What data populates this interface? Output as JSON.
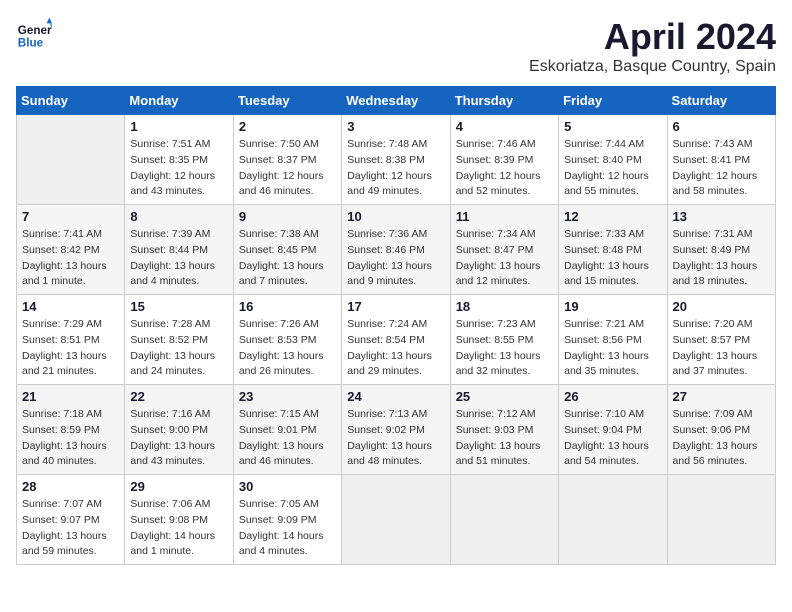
{
  "header": {
    "logo_general": "General",
    "logo_blue": "Blue",
    "month": "April 2024",
    "location": "Eskoriatza, Basque Country, Spain"
  },
  "days_of_week": [
    "Sunday",
    "Monday",
    "Tuesday",
    "Wednesday",
    "Thursday",
    "Friday",
    "Saturday"
  ],
  "weeks": [
    [
      {
        "day": "",
        "info": ""
      },
      {
        "day": "1",
        "info": "Sunrise: 7:51 AM\nSunset: 8:35 PM\nDaylight: 12 hours\nand 43 minutes."
      },
      {
        "day": "2",
        "info": "Sunrise: 7:50 AM\nSunset: 8:37 PM\nDaylight: 12 hours\nand 46 minutes."
      },
      {
        "day": "3",
        "info": "Sunrise: 7:48 AM\nSunset: 8:38 PM\nDaylight: 12 hours\nand 49 minutes."
      },
      {
        "day": "4",
        "info": "Sunrise: 7:46 AM\nSunset: 8:39 PM\nDaylight: 12 hours\nand 52 minutes."
      },
      {
        "day": "5",
        "info": "Sunrise: 7:44 AM\nSunset: 8:40 PM\nDaylight: 12 hours\nand 55 minutes."
      },
      {
        "day": "6",
        "info": "Sunrise: 7:43 AM\nSunset: 8:41 PM\nDaylight: 12 hours\nand 58 minutes."
      }
    ],
    [
      {
        "day": "7",
        "info": "Sunrise: 7:41 AM\nSunset: 8:42 PM\nDaylight: 13 hours\nand 1 minute."
      },
      {
        "day": "8",
        "info": "Sunrise: 7:39 AM\nSunset: 8:44 PM\nDaylight: 13 hours\nand 4 minutes."
      },
      {
        "day": "9",
        "info": "Sunrise: 7:38 AM\nSunset: 8:45 PM\nDaylight: 13 hours\nand 7 minutes."
      },
      {
        "day": "10",
        "info": "Sunrise: 7:36 AM\nSunset: 8:46 PM\nDaylight: 13 hours\nand 9 minutes."
      },
      {
        "day": "11",
        "info": "Sunrise: 7:34 AM\nSunset: 8:47 PM\nDaylight: 13 hours\nand 12 minutes."
      },
      {
        "day": "12",
        "info": "Sunrise: 7:33 AM\nSunset: 8:48 PM\nDaylight: 13 hours\nand 15 minutes."
      },
      {
        "day": "13",
        "info": "Sunrise: 7:31 AM\nSunset: 8:49 PM\nDaylight: 13 hours\nand 18 minutes."
      }
    ],
    [
      {
        "day": "14",
        "info": "Sunrise: 7:29 AM\nSunset: 8:51 PM\nDaylight: 13 hours\nand 21 minutes."
      },
      {
        "day": "15",
        "info": "Sunrise: 7:28 AM\nSunset: 8:52 PM\nDaylight: 13 hours\nand 24 minutes."
      },
      {
        "day": "16",
        "info": "Sunrise: 7:26 AM\nSunset: 8:53 PM\nDaylight: 13 hours\nand 26 minutes."
      },
      {
        "day": "17",
        "info": "Sunrise: 7:24 AM\nSunset: 8:54 PM\nDaylight: 13 hours\nand 29 minutes."
      },
      {
        "day": "18",
        "info": "Sunrise: 7:23 AM\nSunset: 8:55 PM\nDaylight: 13 hours\nand 32 minutes."
      },
      {
        "day": "19",
        "info": "Sunrise: 7:21 AM\nSunset: 8:56 PM\nDaylight: 13 hours\nand 35 minutes."
      },
      {
        "day": "20",
        "info": "Sunrise: 7:20 AM\nSunset: 8:57 PM\nDaylight: 13 hours\nand 37 minutes."
      }
    ],
    [
      {
        "day": "21",
        "info": "Sunrise: 7:18 AM\nSunset: 8:59 PM\nDaylight: 13 hours\nand 40 minutes."
      },
      {
        "day": "22",
        "info": "Sunrise: 7:16 AM\nSunset: 9:00 PM\nDaylight: 13 hours\nand 43 minutes."
      },
      {
        "day": "23",
        "info": "Sunrise: 7:15 AM\nSunset: 9:01 PM\nDaylight: 13 hours\nand 46 minutes."
      },
      {
        "day": "24",
        "info": "Sunrise: 7:13 AM\nSunset: 9:02 PM\nDaylight: 13 hours\nand 48 minutes."
      },
      {
        "day": "25",
        "info": "Sunrise: 7:12 AM\nSunset: 9:03 PM\nDaylight: 13 hours\nand 51 minutes."
      },
      {
        "day": "26",
        "info": "Sunrise: 7:10 AM\nSunset: 9:04 PM\nDaylight: 13 hours\nand 54 minutes."
      },
      {
        "day": "27",
        "info": "Sunrise: 7:09 AM\nSunset: 9:06 PM\nDaylight: 13 hours\nand 56 minutes."
      }
    ],
    [
      {
        "day": "28",
        "info": "Sunrise: 7:07 AM\nSunset: 9:07 PM\nDaylight: 13 hours\nand 59 minutes."
      },
      {
        "day": "29",
        "info": "Sunrise: 7:06 AM\nSunset: 9:08 PM\nDaylight: 14 hours\nand 1 minute."
      },
      {
        "day": "30",
        "info": "Sunrise: 7:05 AM\nSunset: 9:09 PM\nDaylight: 14 hours\nand 4 minutes."
      },
      {
        "day": "",
        "info": ""
      },
      {
        "day": "",
        "info": ""
      },
      {
        "day": "",
        "info": ""
      },
      {
        "day": "",
        "info": ""
      }
    ]
  ]
}
